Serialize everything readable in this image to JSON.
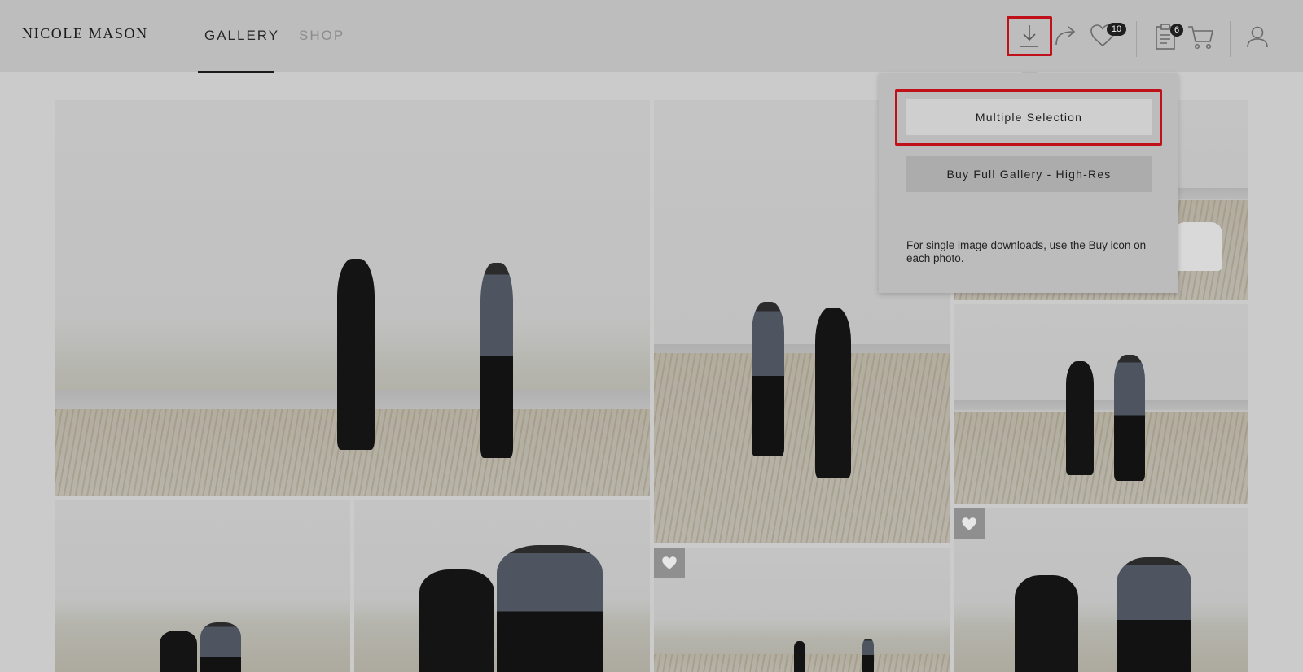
{
  "header": {
    "logo": "NICOLE MASON",
    "tabs": [
      {
        "label": "GALLERY",
        "active": true
      },
      {
        "label": "SHOP",
        "active": false
      }
    ],
    "favorites_count": "10",
    "list_count": "6",
    "highlight_color": "#c0111b"
  },
  "download_menu": {
    "multiple_selection_label": "Multiple Selection",
    "buy_full_gallery_label": "Buy Full Gallery - High-Res",
    "note": "For single image downloads, use the Buy icon on each photo."
  },
  "icons": [
    "download-icon",
    "share-icon",
    "heart-icon",
    "clipboard-icon",
    "cart-icon",
    "user-icon"
  ]
}
